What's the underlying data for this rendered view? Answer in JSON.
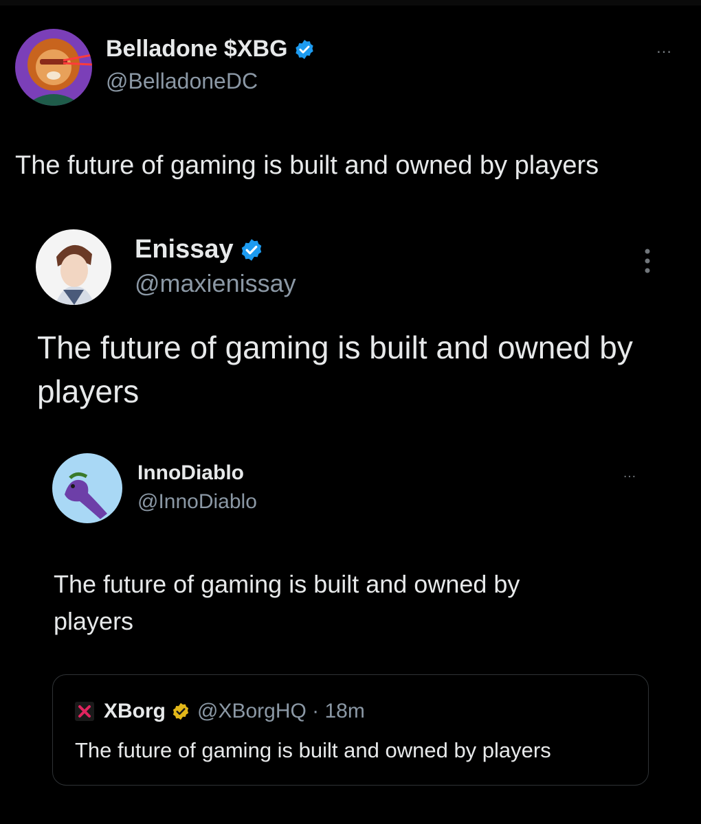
{
  "post1": {
    "display_name": "Belladone $XBG",
    "handle": "@BelladoneDC",
    "text": "The future of gaming is built and owned by players",
    "more_icon": "…"
  },
  "post2": {
    "display_name": "Enissay",
    "handle": "@maxienissay",
    "text": "The future of gaming is built and owned by players"
  },
  "post3": {
    "display_name": "InnoDiablo",
    "handle": "@InnoDiablo",
    "text": "The future of gaming is built and owned by players",
    "more_icon": "…"
  },
  "quote": {
    "display_name": "XBorg",
    "meta": "@XBorgHQ · 18m",
    "text": "The future of gaming is built and owned by players"
  },
  "colors": {
    "background": "#000000",
    "text": "#e7e9ea",
    "secondary": "#8b98a5",
    "verified_blue": "#1d9bf0",
    "verified_gold": "#e2b719",
    "xborg_red": "#e0245e"
  }
}
